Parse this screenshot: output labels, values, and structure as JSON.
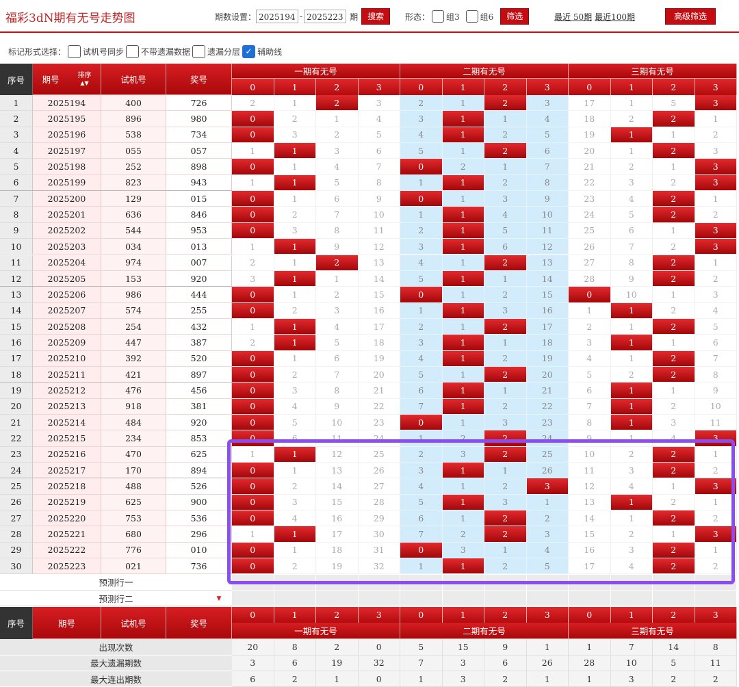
{
  "title": "福彩3dN期有无号走势图",
  "controls": {
    "period_label": "期数设置：",
    "from": "2025194",
    "dash": "-",
    "to": "2025223",
    "period_unit": "期",
    "search": "搜索",
    "form_label": "形态：",
    "group3": "组3",
    "group6": "组6",
    "filter": "筛选",
    "recent50": "最近 50期",
    "recent100": "最近100期",
    "advanced": "高级筛选"
  },
  "markbar": {
    "label": "标记形式选择：",
    "opt1": "试机号同步",
    "opt2": "不带遗漏数据",
    "opt3": "遗漏分层",
    "opt4": "辅助线"
  },
  "header": {
    "seq": "序号",
    "period": "期号",
    "sort": "排序",
    "test": "试机号",
    "award": "奖号",
    "group1": "一期有无号",
    "group2": "二期有无号",
    "group3": "三期有无号",
    "digits": [
      "0",
      "1",
      "2",
      "3",
      "0",
      "1",
      "2",
      "3",
      "0",
      "1",
      "2",
      "3"
    ]
  },
  "rows": [
    {
      "n": "1",
      "p": "2025194",
      "t": "400",
      "a": "726",
      "v": [
        "2",
        "1",
        "2",
        "3",
        "2",
        "1",
        "2",
        "3",
        "17",
        "1",
        "5",
        "3"
      ],
      "h": [
        2,
        6,
        11
      ]
    },
    {
      "n": "2",
      "p": "2025195",
      "t": "896",
      "a": "980",
      "v": [
        "0",
        "2",
        "1",
        "4",
        "3",
        "1",
        "1",
        "4",
        "18",
        "2",
        "2",
        "1"
      ],
      "h": [
        0,
        5,
        10
      ]
    },
    {
      "n": "3",
      "p": "2025196",
      "t": "538",
      "a": "734",
      "v": [
        "0",
        "3",
        "2",
        "5",
        "4",
        "1",
        "2",
        "5",
        "19",
        "1",
        "1",
        "2"
      ],
      "h": [
        0,
        5,
        9
      ]
    },
    {
      "n": "4",
      "p": "2025197",
      "t": "055",
      "a": "057",
      "v": [
        "1",
        "1",
        "3",
        "6",
        "5",
        "1",
        "2",
        "6",
        "20",
        "1",
        "2",
        "3"
      ],
      "h": [
        1,
        6,
        10
      ]
    },
    {
      "n": "5",
      "p": "2025198",
      "t": "252",
      "a": "898",
      "v": [
        "0",
        "1",
        "4",
        "7",
        "0",
        "2",
        "1",
        "7",
        "21",
        "2",
        "1",
        "3"
      ],
      "h": [
        0,
        4,
        11
      ]
    },
    {
      "n": "6",
      "p": "2025199",
      "t": "823",
      "a": "943",
      "v": [
        "1",
        "1",
        "5",
        "8",
        "1",
        "1",
        "2",
        "8",
        "22",
        "3",
        "2",
        "3"
      ],
      "h": [
        1,
        5,
        11
      ]
    },
    {
      "n": "7",
      "p": "2025200",
      "t": "129",
      "a": "015",
      "v": [
        "0",
        "1",
        "6",
        "9",
        "0",
        "1",
        "3",
        "9",
        "23",
        "4",
        "2",
        "1"
      ],
      "h": [
        0,
        4,
        10
      ]
    },
    {
      "n": "8",
      "p": "2025201",
      "t": "636",
      "a": "846",
      "v": [
        "0",
        "2",
        "7",
        "10",
        "1",
        "1",
        "4",
        "10",
        "24",
        "5",
        "2",
        "2"
      ],
      "h": [
        0,
        5,
        10
      ]
    },
    {
      "n": "9",
      "p": "2025202",
      "t": "544",
      "a": "953",
      "v": [
        "0",
        "3",
        "8",
        "11",
        "2",
        "1",
        "5",
        "11",
        "25",
        "6",
        "1",
        "3"
      ],
      "h": [
        0,
        5,
        11
      ]
    },
    {
      "n": "10",
      "p": "2025203",
      "t": "034",
      "a": "013",
      "v": [
        "1",
        "1",
        "9",
        "12",
        "3",
        "1",
        "6",
        "12",
        "26",
        "7",
        "2",
        "3"
      ],
      "h": [
        1,
        5,
        11
      ]
    },
    {
      "n": "11",
      "p": "2025204",
      "t": "974",
      "a": "007",
      "v": [
        "2",
        "1",
        "2",
        "13",
        "4",
        "1",
        "2",
        "13",
        "27",
        "8",
        "2",
        "1"
      ],
      "h": [
        2,
        6,
        10
      ]
    },
    {
      "n": "12",
      "p": "2025205",
      "t": "153",
      "a": "920",
      "v": [
        "3",
        "1",
        "1",
        "14",
        "5",
        "1",
        "1",
        "14",
        "28",
        "9",
        "2",
        "2"
      ],
      "h": [
        1,
        5,
        10
      ]
    },
    {
      "n": "13",
      "p": "2025206",
      "t": "986",
      "a": "444",
      "v": [
        "0",
        "1",
        "2",
        "15",
        "0",
        "1",
        "2",
        "15",
        "0",
        "10",
        "1",
        "3"
      ],
      "h": [
        0,
        4,
        8
      ]
    },
    {
      "n": "14",
      "p": "2025207",
      "t": "574",
      "a": "255",
      "v": [
        "0",
        "2",
        "3",
        "16",
        "1",
        "1",
        "3",
        "16",
        "1",
        "1",
        "2",
        "4"
      ],
      "h": [
        0,
        5,
        9
      ]
    },
    {
      "n": "15",
      "p": "2025208",
      "t": "254",
      "a": "432",
      "v": [
        "1",
        "1",
        "4",
        "17",
        "2",
        "1",
        "2",
        "17",
        "2",
        "1",
        "2",
        "5"
      ],
      "h": [
        1,
        6,
        10
      ]
    },
    {
      "n": "16",
      "p": "2025209",
      "t": "447",
      "a": "387",
      "v": [
        "2",
        "1",
        "5",
        "18",
        "3",
        "1",
        "1",
        "18",
        "3",
        "1",
        "1",
        "6"
      ],
      "h": [
        1,
        5,
        9
      ]
    },
    {
      "n": "17",
      "p": "2025210",
      "t": "392",
      "a": "520",
      "v": [
        "0",
        "1",
        "6",
        "19",
        "4",
        "1",
        "2",
        "19",
        "4",
        "1",
        "2",
        "7"
      ],
      "h": [
        0,
        5,
        10
      ]
    },
    {
      "n": "18",
      "p": "2025211",
      "t": "421",
      "a": "897",
      "v": [
        "0",
        "2",
        "7",
        "20",
        "5",
        "1",
        "2",
        "20",
        "5",
        "2",
        "2",
        "8"
      ],
      "h": [
        0,
        6,
        10
      ]
    },
    {
      "n": "19",
      "p": "2025212",
      "t": "476",
      "a": "456",
      "v": [
        "0",
        "3",
        "8",
        "21",
        "6",
        "1",
        "1",
        "21",
        "6",
        "1",
        "1",
        "9"
      ],
      "h": [
        0,
        5,
        9
      ]
    },
    {
      "n": "20",
      "p": "2025213",
      "t": "918",
      "a": "381",
      "v": [
        "0",
        "4",
        "9",
        "22",
        "7",
        "1",
        "2",
        "22",
        "7",
        "1",
        "2",
        "10"
      ],
      "h": [
        0,
        5,
        9
      ]
    },
    {
      "n": "21",
      "p": "2025214",
      "t": "484",
      "a": "920",
      "v": [
        "0",
        "5",
        "10",
        "23",
        "0",
        "1",
        "3",
        "23",
        "8",
        "1",
        "3",
        "11"
      ],
      "h": [
        0,
        4,
        9
      ]
    },
    {
      "n": "22",
      "p": "2025215",
      "t": "234",
      "a": "853",
      "v": [
        "0",
        "6",
        "11",
        "24",
        "1",
        "2",
        "2",
        "24",
        "9",
        "1",
        "4",
        "3"
      ],
      "h": [
        0,
        6,
        11
      ]
    },
    {
      "n": "23",
      "p": "2025216",
      "t": "470",
      "a": "625",
      "v": [
        "1",
        "1",
        "12",
        "25",
        "2",
        "3",
        "2",
        "25",
        "10",
        "2",
        "2",
        "1"
      ],
      "h": [
        1,
        6,
        10
      ]
    },
    {
      "n": "24",
      "p": "2025217",
      "t": "170",
      "a": "894",
      "v": [
        "0",
        "1",
        "13",
        "26",
        "3",
        "1",
        "1",
        "26",
        "11",
        "3",
        "2",
        "2"
      ],
      "h": [
        0,
        5,
        10
      ]
    },
    {
      "n": "25",
      "p": "2025218",
      "t": "488",
      "a": "526",
      "v": [
        "0",
        "2",
        "14",
        "27",
        "4",
        "1",
        "2",
        "3",
        "12",
        "4",
        "1",
        "3"
      ],
      "h": [
        0,
        7,
        11
      ]
    },
    {
      "n": "26",
      "p": "2025219",
      "t": "625",
      "a": "900",
      "v": [
        "0",
        "3",
        "15",
        "28",
        "5",
        "1",
        "3",
        "1",
        "13",
        "1",
        "2",
        "1"
      ],
      "h": [
        0,
        5,
        9
      ]
    },
    {
      "n": "27",
      "p": "2025220",
      "t": "753",
      "a": "536",
      "v": [
        "0",
        "4",
        "16",
        "29",
        "6",
        "1",
        "2",
        "2",
        "14",
        "1",
        "2",
        "2"
      ],
      "h": [
        0,
        6,
        10
      ]
    },
    {
      "n": "28",
      "p": "2025221",
      "t": "680",
      "a": "296",
      "v": [
        "1",
        "1",
        "17",
        "30",
        "7",
        "2",
        "2",
        "3",
        "15",
        "2",
        "1",
        "3"
      ],
      "h": [
        1,
        6,
        11
      ]
    },
    {
      "n": "29",
      "p": "2025222",
      "t": "776",
      "a": "010",
      "v": [
        "0",
        "1",
        "18",
        "31",
        "0",
        "3",
        "1",
        "4",
        "16",
        "3",
        "2",
        "1"
      ],
      "h": [
        0,
        4,
        10
      ]
    },
    {
      "n": "30",
      "p": "2025223",
      "t": "021",
      "a": "736",
      "v": [
        "0",
        "2",
        "19",
        "32",
        "1",
        "1",
        "2",
        "5",
        "17",
        "4",
        "2",
        "2"
      ],
      "h": [
        0,
        5,
        10
      ]
    }
  ],
  "predict": {
    "row1": "预测行一",
    "row2": "预测行二"
  },
  "stats": [
    {
      "label": "出现次数",
      "v": [
        "20",
        "8",
        "2",
        "0",
        "5",
        "15",
        "9",
        "1",
        "1",
        "7",
        "14",
        "8"
      ]
    },
    {
      "label": "最大遗漏期数",
      "v": [
        "3",
        "6",
        "19",
        "32",
        "7",
        "3",
        "6",
        "26",
        "28",
        "10",
        "5",
        "11"
      ]
    },
    {
      "label": "最大连出期数",
      "v": [
        "6",
        "2",
        "1",
        "0",
        "1",
        "3",
        "2",
        "1",
        "1",
        "3",
        "2",
        "2"
      ]
    }
  ],
  "colors": {
    "brand_red": "#c40f13",
    "missing_blue": "#d3ecfb",
    "highlight_box": "#8a4df0"
  }
}
